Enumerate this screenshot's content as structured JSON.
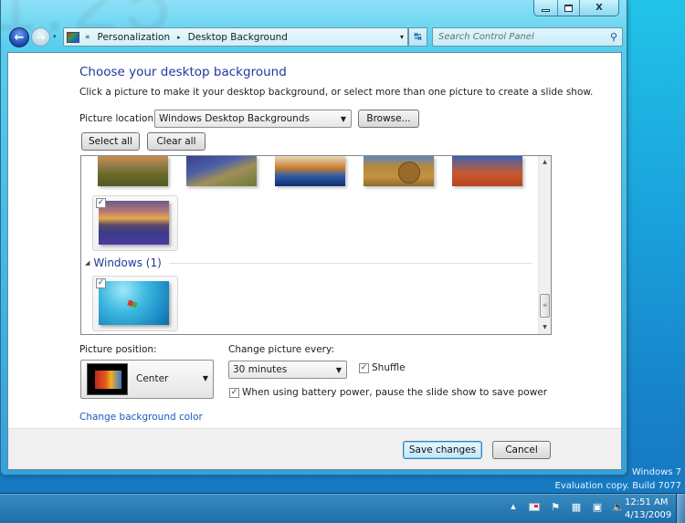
{
  "desktop": {
    "clock_overlay": "1:25",
    "watermark": {
      "line1": "Windows 7",
      "line2": "Evaluation copy. Build 7077"
    }
  },
  "window": {
    "caption_buttons": {
      "minimize": "minimize",
      "maximize": "maximize",
      "close": "X"
    },
    "nav": {
      "back_icon": "←",
      "forward_icon": "→",
      "history_icon": "▾"
    },
    "address": {
      "chevron": "«",
      "crumbs": [
        "Personalization",
        "Desktop Background"
      ],
      "separator": "▸",
      "dropdown": "▾"
    },
    "refresh_icon": "↹",
    "search": {
      "placeholder": "Search Control Panel",
      "icon": "⚲"
    }
  },
  "main": {
    "title": "Choose your desktop background",
    "description": "Click a picture to make it your desktop background, or select more than one picture to create a slide show.",
    "picture_location": {
      "label": "Picture location:",
      "value": "Windows Desktop Backgrounds",
      "arrow": "▼"
    },
    "browse_label": "Browse...",
    "select_all_label": "Select all",
    "clear_all_label": "Clear all",
    "pictures": {
      "partial_row": [
        "landscape-fence",
        "lighthouse-coast",
        "sea-stack-reflection",
        "hay-bale-field",
        "desert-arch"
      ],
      "sunset_item": {
        "checked": true,
        "check": "✓"
      },
      "groups": [
        {
          "toggle": "◢",
          "title": "Windows (1)",
          "items": [
            {
              "name": "windows-7-default",
              "checked": true,
              "check": "✓"
            }
          ]
        }
      ],
      "scroll": {
        "up": "▲",
        "down": "▼",
        "grip": "≡"
      }
    },
    "picture_position": {
      "label": "Picture position:",
      "value": "Center",
      "arrow": "▼"
    },
    "change_every": {
      "label": "Change picture every:",
      "value": "30 minutes",
      "arrow": "▼"
    },
    "shuffle": {
      "label": "Shuffle",
      "checked": true,
      "check": "✓"
    },
    "battery": {
      "label": "When using battery power, pause the slide show to save power",
      "checked": true,
      "check": "✓"
    },
    "bg_color_link": "Change background color",
    "save_label": "Save changes",
    "cancel_label": "Cancel"
  },
  "taskbar": {
    "tray": {
      "show_hidden": "▲",
      "volume": "🔈"
    },
    "time": "12:51 AM",
    "date": "4/13/2009"
  }
}
